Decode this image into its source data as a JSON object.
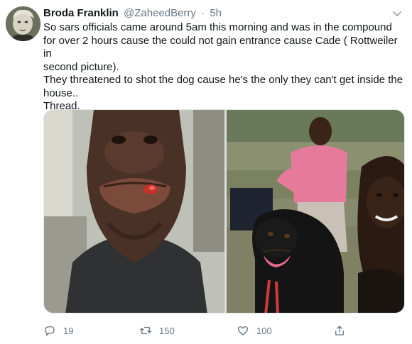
{
  "tweet": {
    "author_name": "Broda Franklin",
    "author_handle": "@ZaheedBerry",
    "separator": "·",
    "time": "5h",
    "text": "So sars officials came around 5am this morning and was in the compound\nfor over 2 hours cause the could not gain entrance cause Cade ( Rottweiler in\nsecond picture).\nThey threatened to shot the dog cause he's the only they can't get inside the\nhouse..\nThread.",
    "actions": {
      "replies": "19",
      "retweets": "150",
      "likes": "100"
    }
  },
  "colors": {
    "text_primary": "#14171a",
    "text_secondary": "#657786",
    "border": "#e1e8ed"
  },
  "icons": [
    "chevron-down-icon",
    "reply-icon",
    "retweet-icon",
    "like-icon",
    "share-icon"
  ]
}
